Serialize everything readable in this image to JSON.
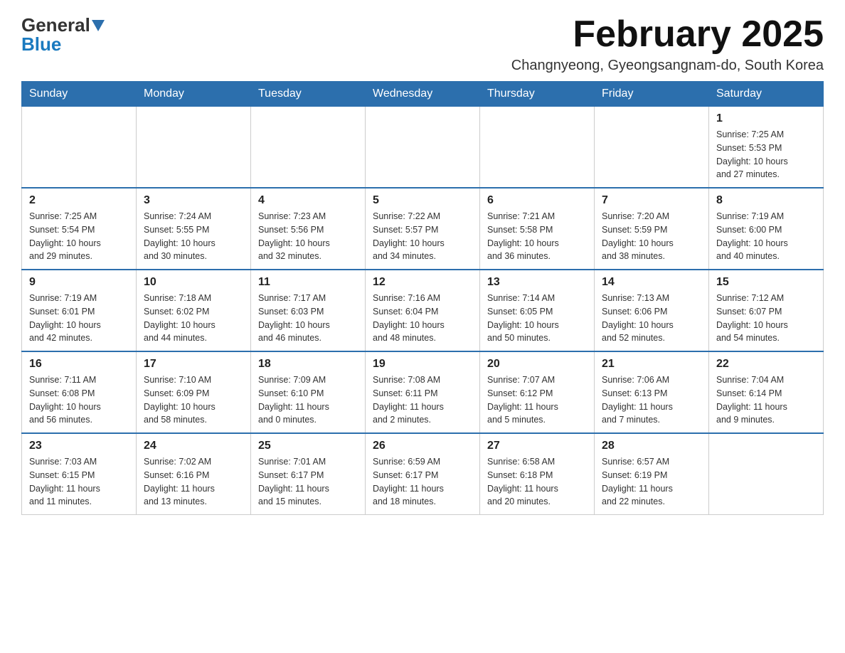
{
  "header": {
    "logo_general": "General",
    "logo_blue": "Blue",
    "title": "February 2025",
    "location": "Changnyeong, Gyeongsangnam-do, South Korea"
  },
  "weekdays": [
    "Sunday",
    "Monday",
    "Tuesday",
    "Wednesday",
    "Thursday",
    "Friday",
    "Saturday"
  ],
  "weeks": [
    [
      {
        "day": "",
        "info": ""
      },
      {
        "day": "",
        "info": ""
      },
      {
        "day": "",
        "info": ""
      },
      {
        "day": "",
        "info": ""
      },
      {
        "day": "",
        "info": ""
      },
      {
        "day": "",
        "info": ""
      },
      {
        "day": "1",
        "info": "Sunrise: 7:25 AM\nSunset: 5:53 PM\nDaylight: 10 hours\nand 27 minutes."
      }
    ],
    [
      {
        "day": "2",
        "info": "Sunrise: 7:25 AM\nSunset: 5:54 PM\nDaylight: 10 hours\nand 29 minutes."
      },
      {
        "day": "3",
        "info": "Sunrise: 7:24 AM\nSunset: 5:55 PM\nDaylight: 10 hours\nand 30 minutes."
      },
      {
        "day": "4",
        "info": "Sunrise: 7:23 AM\nSunset: 5:56 PM\nDaylight: 10 hours\nand 32 minutes."
      },
      {
        "day": "5",
        "info": "Sunrise: 7:22 AM\nSunset: 5:57 PM\nDaylight: 10 hours\nand 34 minutes."
      },
      {
        "day": "6",
        "info": "Sunrise: 7:21 AM\nSunset: 5:58 PM\nDaylight: 10 hours\nand 36 minutes."
      },
      {
        "day": "7",
        "info": "Sunrise: 7:20 AM\nSunset: 5:59 PM\nDaylight: 10 hours\nand 38 minutes."
      },
      {
        "day": "8",
        "info": "Sunrise: 7:19 AM\nSunset: 6:00 PM\nDaylight: 10 hours\nand 40 minutes."
      }
    ],
    [
      {
        "day": "9",
        "info": "Sunrise: 7:19 AM\nSunset: 6:01 PM\nDaylight: 10 hours\nand 42 minutes."
      },
      {
        "day": "10",
        "info": "Sunrise: 7:18 AM\nSunset: 6:02 PM\nDaylight: 10 hours\nand 44 minutes."
      },
      {
        "day": "11",
        "info": "Sunrise: 7:17 AM\nSunset: 6:03 PM\nDaylight: 10 hours\nand 46 minutes."
      },
      {
        "day": "12",
        "info": "Sunrise: 7:16 AM\nSunset: 6:04 PM\nDaylight: 10 hours\nand 48 minutes."
      },
      {
        "day": "13",
        "info": "Sunrise: 7:14 AM\nSunset: 6:05 PM\nDaylight: 10 hours\nand 50 minutes."
      },
      {
        "day": "14",
        "info": "Sunrise: 7:13 AM\nSunset: 6:06 PM\nDaylight: 10 hours\nand 52 minutes."
      },
      {
        "day": "15",
        "info": "Sunrise: 7:12 AM\nSunset: 6:07 PM\nDaylight: 10 hours\nand 54 minutes."
      }
    ],
    [
      {
        "day": "16",
        "info": "Sunrise: 7:11 AM\nSunset: 6:08 PM\nDaylight: 10 hours\nand 56 minutes."
      },
      {
        "day": "17",
        "info": "Sunrise: 7:10 AM\nSunset: 6:09 PM\nDaylight: 10 hours\nand 58 minutes."
      },
      {
        "day": "18",
        "info": "Sunrise: 7:09 AM\nSunset: 6:10 PM\nDaylight: 11 hours\nand 0 minutes."
      },
      {
        "day": "19",
        "info": "Sunrise: 7:08 AM\nSunset: 6:11 PM\nDaylight: 11 hours\nand 2 minutes."
      },
      {
        "day": "20",
        "info": "Sunrise: 7:07 AM\nSunset: 6:12 PM\nDaylight: 11 hours\nand 5 minutes."
      },
      {
        "day": "21",
        "info": "Sunrise: 7:06 AM\nSunset: 6:13 PM\nDaylight: 11 hours\nand 7 minutes."
      },
      {
        "day": "22",
        "info": "Sunrise: 7:04 AM\nSunset: 6:14 PM\nDaylight: 11 hours\nand 9 minutes."
      }
    ],
    [
      {
        "day": "23",
        "info": "Sunrise: 7:03 AM\nSunset: 6:15 PM\nDaylight: 11 hours\nand 11 minutes."
      },
      {
        "day": "24",
        "info": "Sunrise: 7:02 AM\nSunset: 6:16 PM\nDaylight: 11 hours\nand 13 minutes."
      },
      {
        "day": "25",
        "info": "Sunrise: 7:01 AM\nSunset: 6:17 PM\nDaylight: 11 hours\nand 15 minutes."
      },
      {
        "day": "26",
        "info": "Sunrise: 6:59 AM\nSunset: 6:17 PM\nDaylight: 11 hours\nand 18 minutes."
      },
      {
        "day": "27",
        "info": "Sunrise: 6:58 AM\nSunset: 6:18 PM\nDaylight: 11 hours\nand 20 minutes."
      },
      {
        "day": "28",
        "info": "Sunrise: 6:57 AM\nSunset: 6:19 PM\nDaylight: 11 hours\nand 22 minutes."
      },
      {
        "day": "",
        "info": ""
      }
    ]
  ],
  "colors": {
    "header_bg": "#2c6fad",
    "accent": "#1a7abf"
  }
}
